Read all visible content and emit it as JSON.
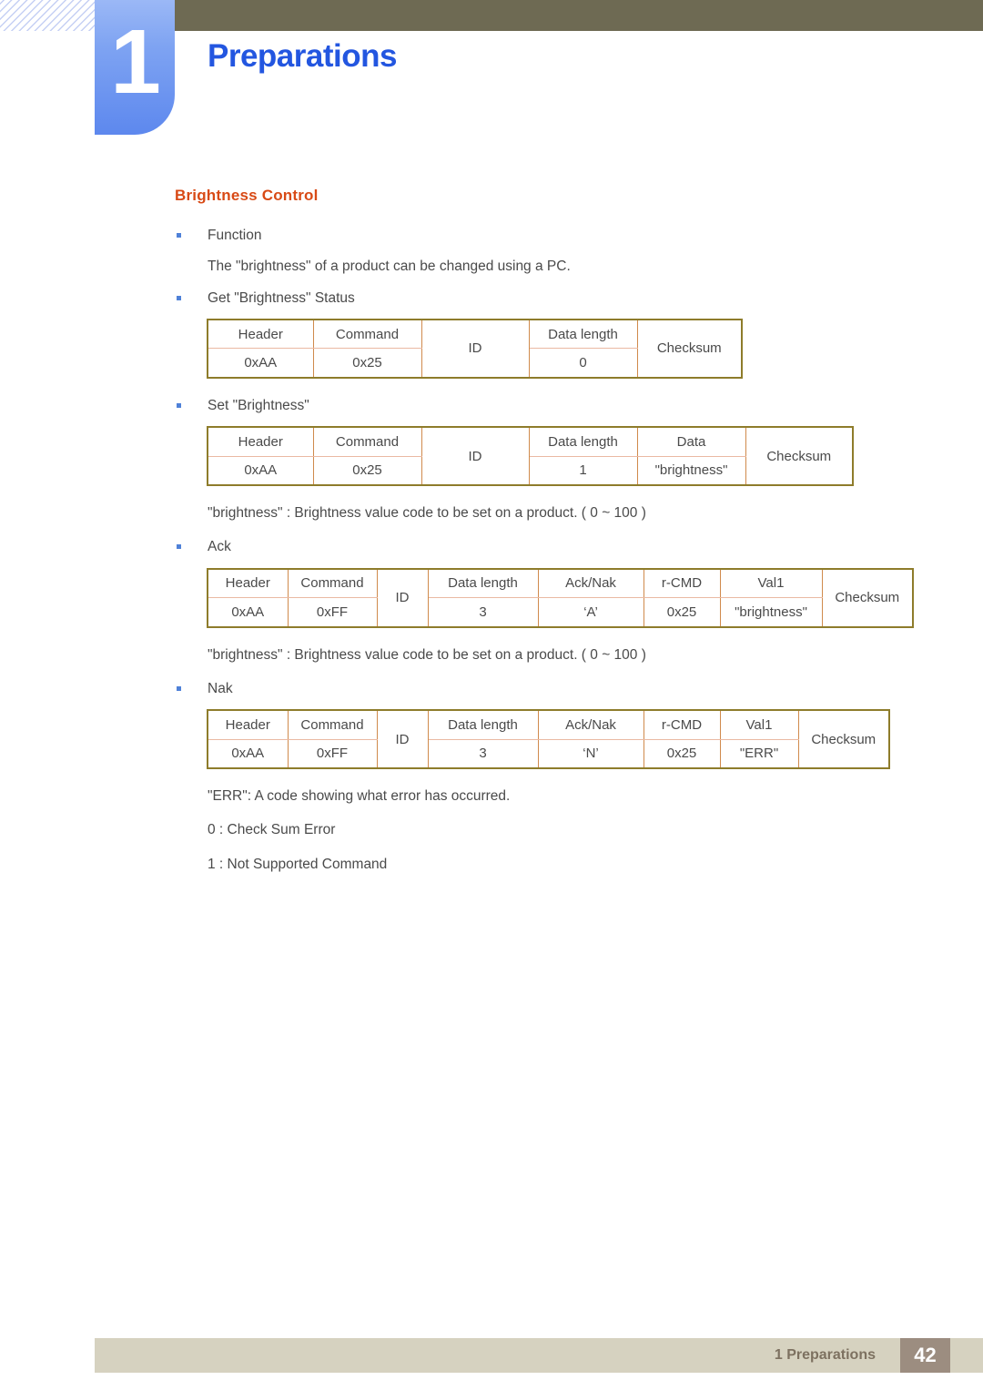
{
  "header": {
    "chapter_number": "1",
    "chapter_title": "Preparations"
  },
  "section": {
    "heading": "Brightness  Control"
  },
  "body": {
    "function_label": "Function",
    "function_desc": "The \"brightness\" of a product can be changed using a PC.",
    "get_status_label": "Get \"Brightness\" Status",
    "set_label": "Set \"Brightness\"",
    "brightness_note_1": "\"brightness\" : Brightness value code to be set on a product. ( 0 ~ 100 )",
    "ack_label": "Ack",
    "brightness_note_2": "\"brightness\" : Brightness value code to be set on a product. ( 0 ~ 100 )",
    "nak_label": "Nak",
    "err_note": "\"ERR\": A code showing what error has occurred.",
    "err_code_0": "0 : Check Sum Error",
    "err_code_1": "1 : Not Supported Command"
  },
  "tables": {
    "get_status": {
      "headers": [
        "Header",
        "Command",
        "ID",
        "Data length",
        "Checksum"
      ],
      "values": [
        "0xAA",
        "0x25",
        "0",
        ""
      ],
      "cells": {
        "header": "Header",
        "command": "Command",
        "id": "ID",
        "data_length": "Data length",
        "checksum": "Checksum",
        "header_val": "0xAA",
        "command_val": "0x25",
        "data_length_val": "0"
      }
    },
    "set_brightness": {
      "cells": {
        "header": "Header",
        "command": "Command",
        "id": "ID",
        "data_length": "Data length",
        "data": "Data",
        "checksum": "Checksum",
        "header_val": "0xAA",
        "command_val": "0x25",
        "data_length_val": "1",
        "data_val": "\"brightness\""
      }
    },
    "ack": {
      "cells": {
        "header": "Header",
        "command": "Command",
        "id": "ID",
        "data_length": "Data length",
        "ack_nak": "Ack/Nak",
        "r_cmd": "r-CMD",
        "val1": "Val1",
        "checksum": "Checksum",
        "header_val": "0xAA",
        "command_val": "0xFF",
        "data_length_val": "3",
        "ack_nak_val": "‘A’",
        "r_cmd_val": "0x25",
        "val1_val": "\"brightness\""
      }
    },
    "nak": {
      "cells": {
        "header": "Header",
        "command": "Command",
        "id": "ID",
        "data_length": "Data length",
        "ack_nak": "Ack/Nak",
        "r_cmd": "r-CMD",
        "val1": "Val1",
        "checksum": "Checksum",
        "header_val": "0xAA",
        "command_val": "0xFF",
        "data_length_val": "3",
        "ack_nak_val": "‘N’",
        "r_cmd_val": "0x25",
        "val1_val": "\"ERR\""
      }
    }
  },
  "footer": {
    "chapter_ref": "1 Preparations",
    "page_number": "42"
  },
  "colors": {
    "topbar": "#6e6a53",
    "chapter_blue": "#2356e0",
    "badge_blue": "#5d88ee",
    "section_orange": "#d84a16",
    "table_outer_border": "#8e7c2b",
    "table_vertical_rule": "#d08a4c",
    "table_horizontal_rule": "#eab9a3",
    "footer_bar": "#d6d2c0",
    "page_num_box": "#9c8d80",
    "bullet": "#4f81d8"
  }
}
